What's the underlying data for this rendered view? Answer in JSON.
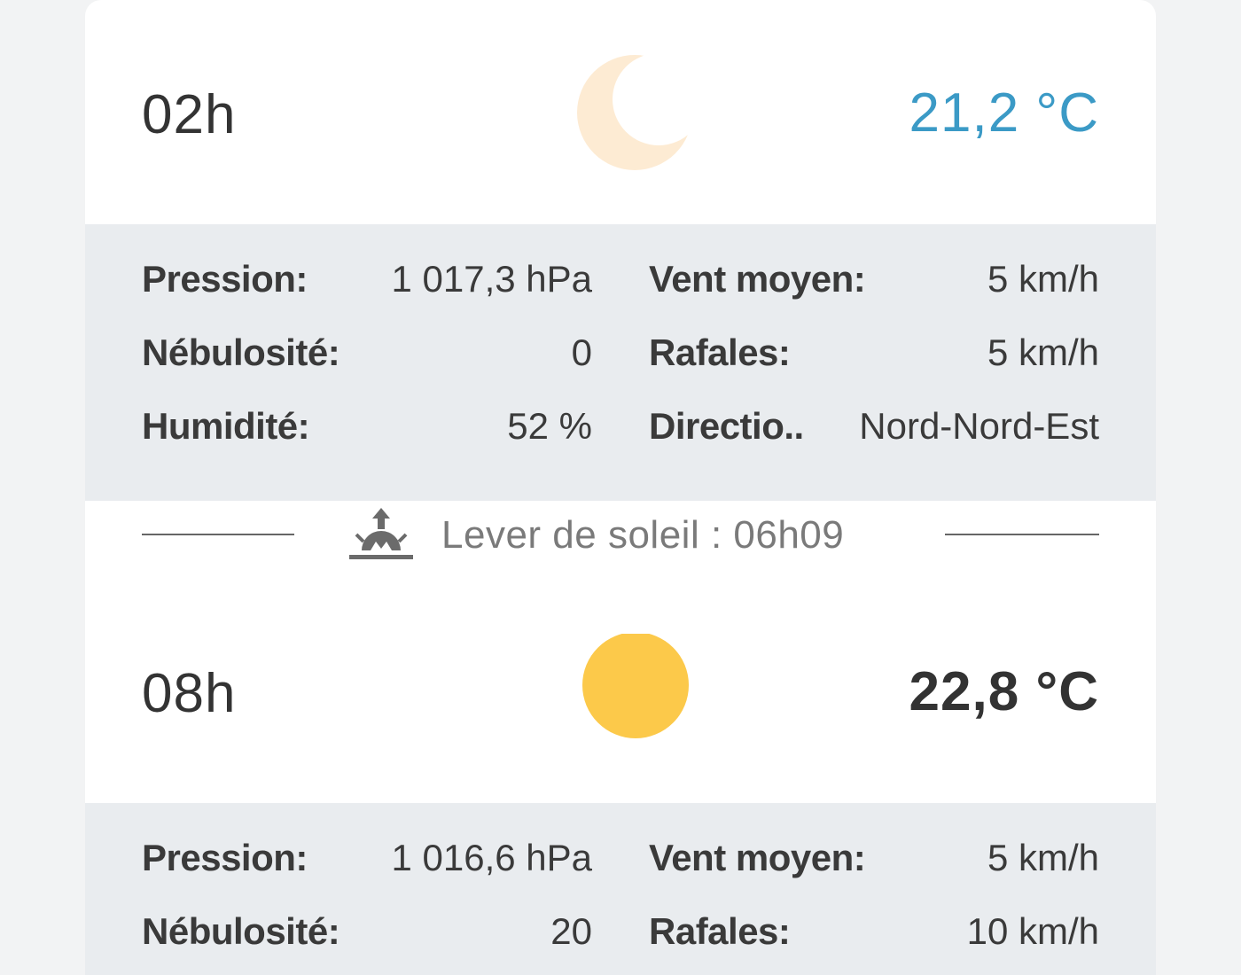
{
  "slots": [
    {
      "hour": "02h",
      "icon": "moon-icon",
      "temperature": "21,2 °C",
      "temp_color": "#3b9ac6",
      "details": {
        "pressure_label": "Pression:",
        "pressure_value": "1 017,3 hPa",
        "cloud_label": "Nébulosité:",
        "cloud_value": "0",
        "humidity_label": "Humidité:",
        "humidity_value": "52 %",
        "wind_label": "Vent moyen:",
        "wind_value": "5 km/h",
        "gust_label": "Rafales:",
        "gust_value": "5 km/h",
        "direction_label": "Directio..",
        "direction_value": "Nord-Nord-Est"
      }
    },
    {
      "hour": "08h",
      "icon": "sun-icon",
      "temperature": "22,8 °C",
      "temp_color": "#333333",
      "details": {
        "pressure_label": "Pression:",
        "pressure_value": "1 016,6 hPa",
        "cloud_label": "Nébulosité:",
        "cloud_value": "20",
        "wind_label": "Vent moyen:",
        "wind_value": "5 km/h",
        "gust_label": "Rafales:",
        "gust_value": "10 km/h"
      }
    }
  ],
  "sunrise": {
    "icon": "sunrise-icon",
    "text": "Lever de soleil : 06h09"
  },
  "colors": {
    "moon": "#fdebd3",
    "sun": "#fcc94a",
    "detail_bg": "#e9ecef"
  }
}
